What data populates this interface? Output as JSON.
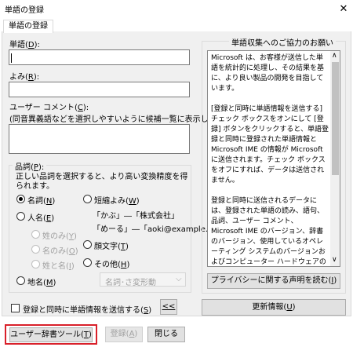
{
  "window": {
    "title": "単語の登録",
    "close_glyph": "✕"
  },
  "tab": {
    "label": "単語の登録"
  },
  "word": {
    "label_prefix": "単語(",
    "label_key": "D",
    "label_suffix": "):",
    "value": ""
  },
  "reading": {
    "label_prefix": "よみ(",
    "label_key": "R",
    "label_suffix": "):",
    "value": ""
  },
  "comment": {
    "label_prefix": "ユーザー コメント(",
    "label_key": "C",
    "label_suffix": "):",
    "hint": "(同音異義語などを選択しやすいように候補一覧に表示します)",
    "value": ""
  },
  "pos": {
    "title_prefix": "品詞(",
    "title_key": "P",
    "title_suffix": "):",
    "description": "正しい品詞を選択すると、より高い変換精度を得られます。",
    "noun": {
      "label": "名詞(",
      "key": "N",
      "suffix": ")",
      "checked": true
    },
    "short": {
      "label": "短縮よみ(",
      "key": "W",
      "suffix": ")",
      "checked": false
    },
    "person": {
      "label": "人名(",
      "key": "E",
      "suffix": ")",
      "checked": false
    },
    "person_surname": {
      "label": "姓のみ(",
      "key": "Y",
      "suffix": ")"
    },
    "person_given": {
      "label": "名のみ(",
      "key": "O",
      "suffix": ")"
    },
    "person_full": {
      "label": "姓と名(",
      "key": "I",
      "suffix": ")"
    },
    "example1": "「かぶ」―「株式会社」",
    "example2": "「めーる」―「aoki@example.com",
    "emoticon": {
      "label": "顔文字(",
      "key": "T",
      "suffix": ")",
      "checked": false
    },
    "other": {
      "label": "その他(",
      "key": "H",
      "suffix": ")",
      "checked": false
    },
    "place": {
      "label": "地名(",
      "key": "M",
      "suffix": ")",
      "checked": false
    },
    "subcategory": {
      "value": "名詞･さ変形動",
      "arrow": "⌵"
    }
  },
  "send_checkbox": {
    "label_prefix": "登録と同時に単語情報を送信する(",
    "label_key": "S",
    "label_suffix": ")",
    "checked": false
  },
  "collapse_button": {
    "label": "<<"
  },
  "privacy_group": {
    "title": "単語収集へのご協力のお願い",
    "text": "Microsoft は、お客様が送信した単語を統計的に処理し、その結果を基に、より良い製品の開発を目指しています。\n\n[登録と同時に単語情報を送信する] チェック ボックスをオンにして [登録] ボタンをクリックすると、単語登録と同時に登録された単語情報と Microsoft IME の情報が Microsoft に送信されます。チェック ボックスをオフにすれば、データは送信されません。\n\n登録と同時に送信されるデータには、登録された単語の読み、語句、品詞、ユーザー コメント、Microsoft IME のバージョン、辞書のバージョン、使用しているオペレーティング システムのバージョンおよびコンピューター ハードウェアの情報、コンピューターのインターネット プロトコル (IP) アドレスが含まれます。\n\nお客様特有の情報が収集されたデータに含まれる場合があります。このような情報が",
    "privacy_button": "プライバシーに関する声明を読む(",
    "privacy_key": "I",
    "privacy_suffix": ")",
    "scroll_up": "∧",
    "scroll_down": "∨"
  },
  "update_button": {
    "label": "更新情報(",
    "key": "U",
    "suffix": ")"
  },
  "footer": {
    "user_dict_tool": {
      "label": "ユーザー辞書ツール(",
      "key": "T",
      "suffix": ")"
    },
    "register": {
      "label": "登録(",
      "key": "A",
      "suffix": ")"
    },
    "close": {
      "label": "閉じる"
    }
  },
  "colors": {
    "highlight": "#d9202a",
    "panel_bg": "#f0f0f0"
  }
}
